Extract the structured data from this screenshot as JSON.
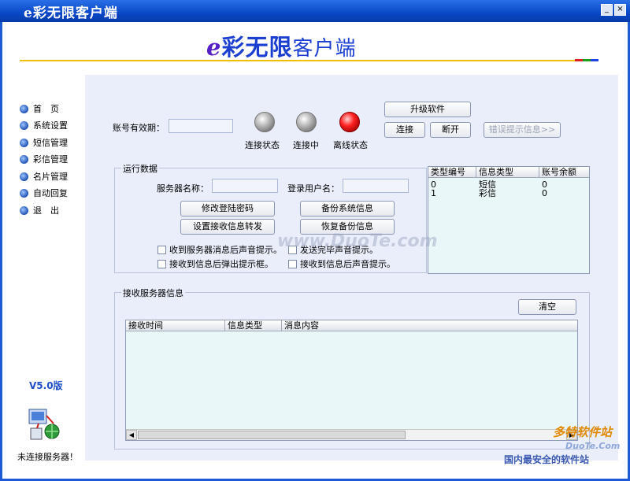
{
  "window": {
    "title": "e彩无限客户端",
    "close_symbol": "×",
    "minimize_symbol": "_"
  },
  "header": {
    "logo_e": "e",
    "logo_main": "彩无限",
    "logo_suffix": "客户端"
  },
  "sidebar": {
    "items": [
      {
        "label": "首　页"
      },
      {
        "label": "系统设置"
      },
      {
        "label": "短信管理"
      },
      {
        "label": "彩信管理"
      },
      {
        "label": "名片管理"
      },
      {
        "label": "自动回复"
      },
      {
        "label": "退　出"
      }
    ],
    "version": "V5.0版",
    "server_status": "未连接服务器！"
  },
  "account": {
    "validity_label": "账号有效期："
  },
  "indicators": [
    {
      "label": "连接状态",
      "color": "gray"
    },
    {
      "label": "连接中",
      "color": "gray"
    },
    {
      "label": "离线状态",
      "color": "red"
    }
  ],
  "buttons": {
    "upgrade": "升级软件",
    "connect": "连接",
    "disconnect": "断开",
    "error_info": "错误提示信息>>"
  },
  "run_data": {
    "title": "运行数据",
    "server_name_label": "服务器名称：",
    "login_user_label": "登录用户名：",
    "change_password": "修改登陆密码",
    "backup_system": "备份系统信息",
    "set_forward": "设置接收信息转发",
    "restore_backup": "恢复备份信息",
    "checkboxes": [
      {
        "label": "收到服务器消息后声音提示。"
      },
      {
        "label": "发送完毕声音提示。"
      },
      {
        "label": "接收到信息后弹出提示框。"
      },
      {
        "label": "接收到信息后声音提示。"
      }
    ]
  },
  "type_table": {
    "headers": [
      "类型编号",
      "信息类型",
      "账号余额"
    ],
    "rows": [
      [
        "0",
        "短信",
        "0"
      ],
      [
        "1",
        "彩信",
        "0"
      ]
    ]
  },
  "receive": {
    "title": "接收服务器信息",
    "clear": "清空",
    "headers": [
      "接收时间",
      "信息类型",
      "消息内容"
    ]
  },
  "watermarks": {
    "center": "www.DuoTe.com",
    "corner": "国内最安全的软件站",
    "corner_brand": "多特软件站",
    "corner_url": "DuoTe.Com"
  }
}
